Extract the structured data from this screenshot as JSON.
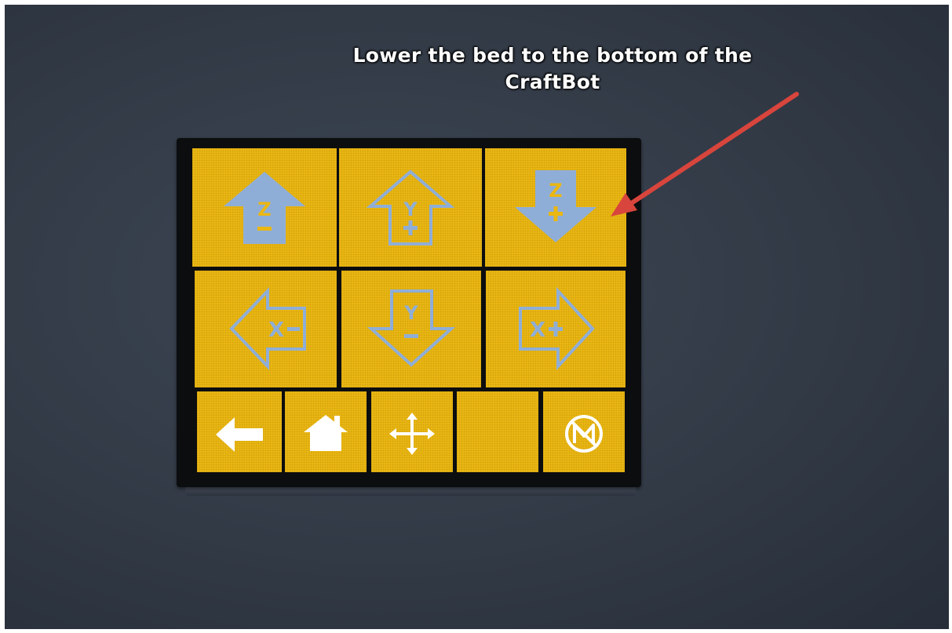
{
  "caption": {
    "line1": "Lower the bed to the bottom of the",
    "line2": "CraftBot"
  },
  "jog_grid": [
    {
      "id": "z-up",
      "axis": "Z",
      "sign": "−",
      "direction": "up",
      "style": "solid"
    },
    {
      "id": "y-plus",
      "axis": "Y",
      "sign": "+",
      "direction": "up",
      "style": "outline"
    },
    {
      "id": "z-down",
      "axis": "Z",
      "sign": "+",
      "direction": "down",
      "style": "solid"
    },
    {
      "id": "x-minus",
      "axis": "X−",
      "direction": "left",
      "style": "outline"
    },
    {
      "id": "y-minus",
      "axis": "Y",
      "sign": "−",
      "direction": "down",
      "style": "outline"
    },
    {
      "id": "x-plus",
      "axis": "X+",
      "direction": "right",
      "style": "outline"
    }
  ],
  "bottom_bar": [
    {
      "id": "back",
      "icon": "back-arrow-icon"
    },
    {
      "id": "home",
      "icon": "home-icon"
    },
    {
      "id": "move",
      "icon": "move-arrows-icon"
    },
    {
      "id": "blank",
      "icon": ""
    },
    {
      "id": "motors-off",
      "icon": "motors-off-icon"
    }
  ],
  "colors": {
    "tile": "#ebb712",
    "icon_blue": "#8faed7",
    "icon_white": "#ffffff",
    "annotation_arrow": "#d8453c",
    "background": "#323a46"
  }
}
